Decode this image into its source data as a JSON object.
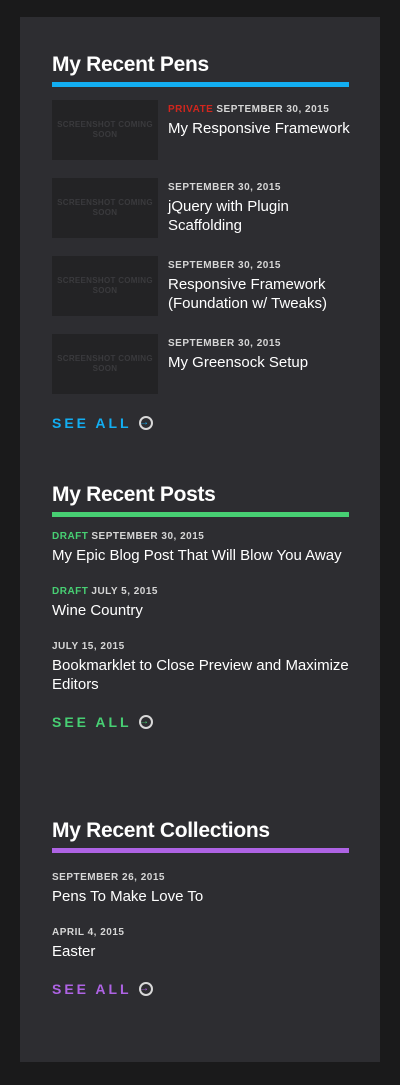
{
  "colors": {
    "pens": "#12aef2",
    "posts": "#47cf73",
    "collections": "#ae63e4"
  },
  "pens": {
    "title": "My Recent Pens",
    "see_all": "SEE ALL",
    "items": [
      {
        "thumb": "SCREENSHOT COMING SOON",
        "tag": "PRIVATE",
        "date": "SEPTEMBER 30, 2015",
        "title": "My Responsive Framework"
      },
      {
        "thumb": "SCREENSHOT COMING SOON",
        "date": "SEPTEMBER 30, 2015",
        "title": "jQuery with Plugin Scaffolding"
      },
      {
        "thumb": "SCREENSHOT COMING SOON",
        "date": "SEPTEMBER 30, 2015",
        "title": "Responsive Framework (Foundation w/ Tweaks)"
      },
      {
        "thumb": "SCREENSHOT COMING SOON",
        "date": "SEPTEMBER 30, 2015",
        "title": "My Greensock Setup"
      }
    ]
  },
  "posts": {
    "title": "My Recent Posts",
    "see_all": "SEE ALL",
    "items": [
      {
        "tag": "DRAFT",
        "date": "SEPTEMBER 30, 2015",
        "title": "My Epic Blog Post That Will Blow You Away"
      },
      {
        "tag": "DRAFT",
        "date": "JULY 5, 2015",
        "title": "Wine Country"
      },
      {
        "date": "JULY 15, 2015",
        "title": "Bookmarklet to Close Preview and Maximize Editors"
      }
    ]
  },
  "collections": {
    "title": "My Recent Collections",
    "see_all": "SEE ALL",
    "items": [
      {
        "date": "SEPTEMBER 26, 2015",
        "title": "Pens To Make Love To"
      },
      {
        "date": "APRIL 4, 2015",
        "title": "Easter"
      }
    ]
  }
}
